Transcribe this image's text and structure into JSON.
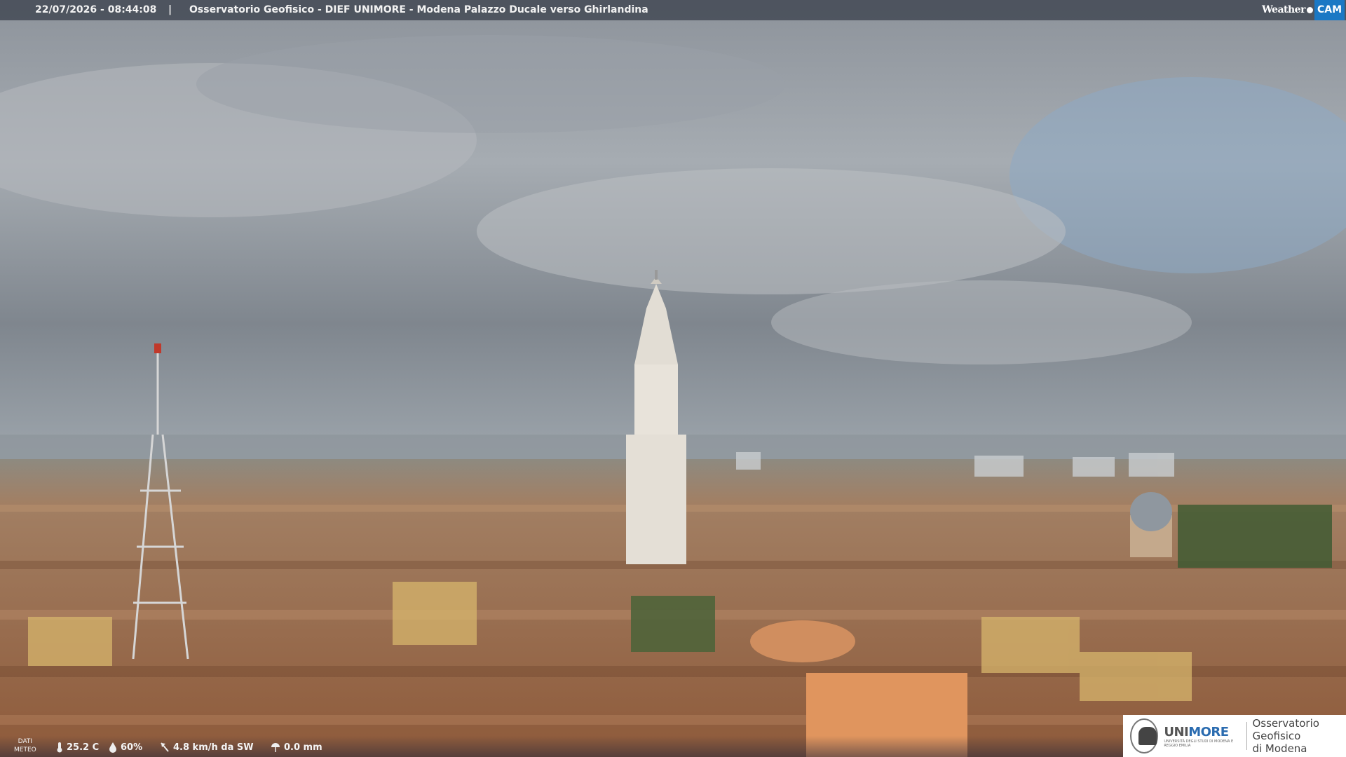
{
  "header": {
    "timestamp": "22/07/2026 - 08:44:08",
    "separator": "|",
    "title": "Osservatorio Geofisico - DIEF UNIMORE - Modena Palazzo Ducale verso Ghirlandina"
  },
  "brand": {
    "part1": "Weather",
    "part2": "CAM"
  },
  "weather": {
    "label_line1": "DATI",
    "label_line2": "METEO",
    "temperature": "25.2 C",
    "humidity": "60%",
    "wind": "4.8 km/h da SW",
    "rain": "0.0 mm"
  },
  "logo": {
    "uni_prefix": "UNI",
    "uni_suffix": "MORE",
    "uni_sub": "UNIVERSITÀ DEGLI STUDI DI MODENA E REGGIO EMILIA",
    "obs_line1": "Osservatorio Geofisico",
    "obs_line2": "di Modena"
  },
  "colors": {
    "topbar": "#3c424e",
    "unimore_blue": "#2b6cb0",
    "weathercam_blue": "#1b78c4"
  }
}
